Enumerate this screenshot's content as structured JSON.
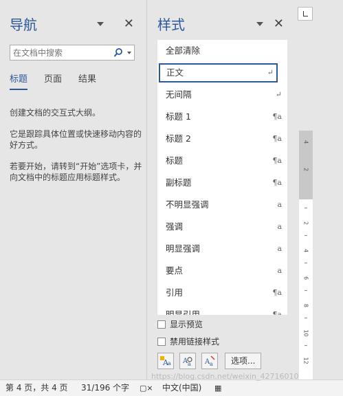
{
  "navigation": {
    "title": "导航",
    "search_placeholder": "在文档中搜索",
    "tabs": [
      {
        "label": "标题",
        "active": true
      },
      {
        "label": "页面",
        "active": false
      },
      {
        "label": "结果",
        "active": false
      }
    ],
    "paragraphs": [
      "创建文档的交互式大纲。",
      "它是跟踪具体位置或快速移动内容的好方式。",
      "若要开始，请转到“开始”选项卡，并向文档中的标题应用标题样式。"
    ]
  },
  "styles": {
    "title": "样式",
    "items": [
      {
        "label": "全部清除",
        "mark": ""
      },
      {
        "label": "正文",
        "mark": "↵",
        "selected": true
      },
      {
        "label": "无间隔",
        "mark": "↵"
      },
      {
        "label": "标题 1",
        "mark": "¶a"
      },
      {
        "label": "标题 2",
        "mark": "¶a"
      },
      {
        "label": "标题",
        "mark": "¶a"
      },
      {
        "label": "副标题",
        "mark": "¶a"
      },
      {
        "label": "不明显强调",
        "mark": "a"
      },
      {
        "label": "强调",
        "mark": "a"
      },
      {
        "label": "明显强调",
        "mark": "a"
      },
      {
        "label": "要点",
        "mark": "a"
      },
      {
        "label": "引用",
        "mark": "¶a"
      },
      {
        "label": "明显引用",
        "mark": "¶a"
      }
    ],
    "show_preview_label": "显示预览",
    "disable_linked_label": "禁用链接样式",
    "options_label": "选项..."
  },
  "ruler": {
    "numbers": [
      "4",
      "2",
      "2",
      "4",
      "6",
      "8",
      "10",
      "12"
    ]
  },
  "status": {
    "page": "第 4 页，共 4 页",
    "words": "31/196 个字",
    "language": "中文(中国)"
  },
  "watermark": "https://blog.csdn.net/weixin_42716010",
  "colors": {
    "accent": "#2b579a"
  }
}
